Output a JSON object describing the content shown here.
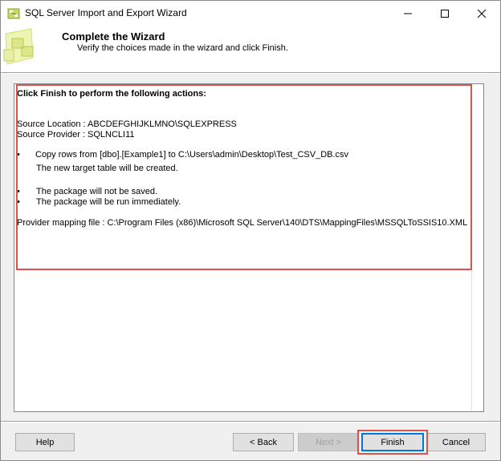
{
  "window": {
    "title": "SQL Server Import and Export Wizard"
  },
  "header": {
    "title": "Complete the Wizard",
    "subtitle": "Verify the choices made in the wizard and click Finish."
  },
  "summary": {
    "heading": "Click Finish to perform the following actions:",
    "source_location": "Source Location : ABCDEFGHIJKLMNO\\SQLEXPRESS",
    "source_provider": "Source Provider : SQLNCLI11",
    "actions": [
      "Copy rows from [dbo].[Example1] to C:\\Users\\admin\\Desktop\\Test_CSV_DB.csv",
      "The new target table will be created.",
      "The package will not be saved.",
      "The package will be run immediately."
    ],
    "mapping_file": "Provider mapping file : C:\\Program Files (x86)\\Microsoft SQL Server\\140\\DTS\\MappingFiles\\MSSQLToSSIS10.XML",
    "bullet": "•"
  },
  "buttons": {
    "help": "Help",
    "back": "< Back",
    "next": "Next >",
    "finish": "Finish",
    "cancel": "Cancel"
  },
  "colors": {
    "highlight": "#d9534f",
    "accent": "#0078d7"
  }
}
